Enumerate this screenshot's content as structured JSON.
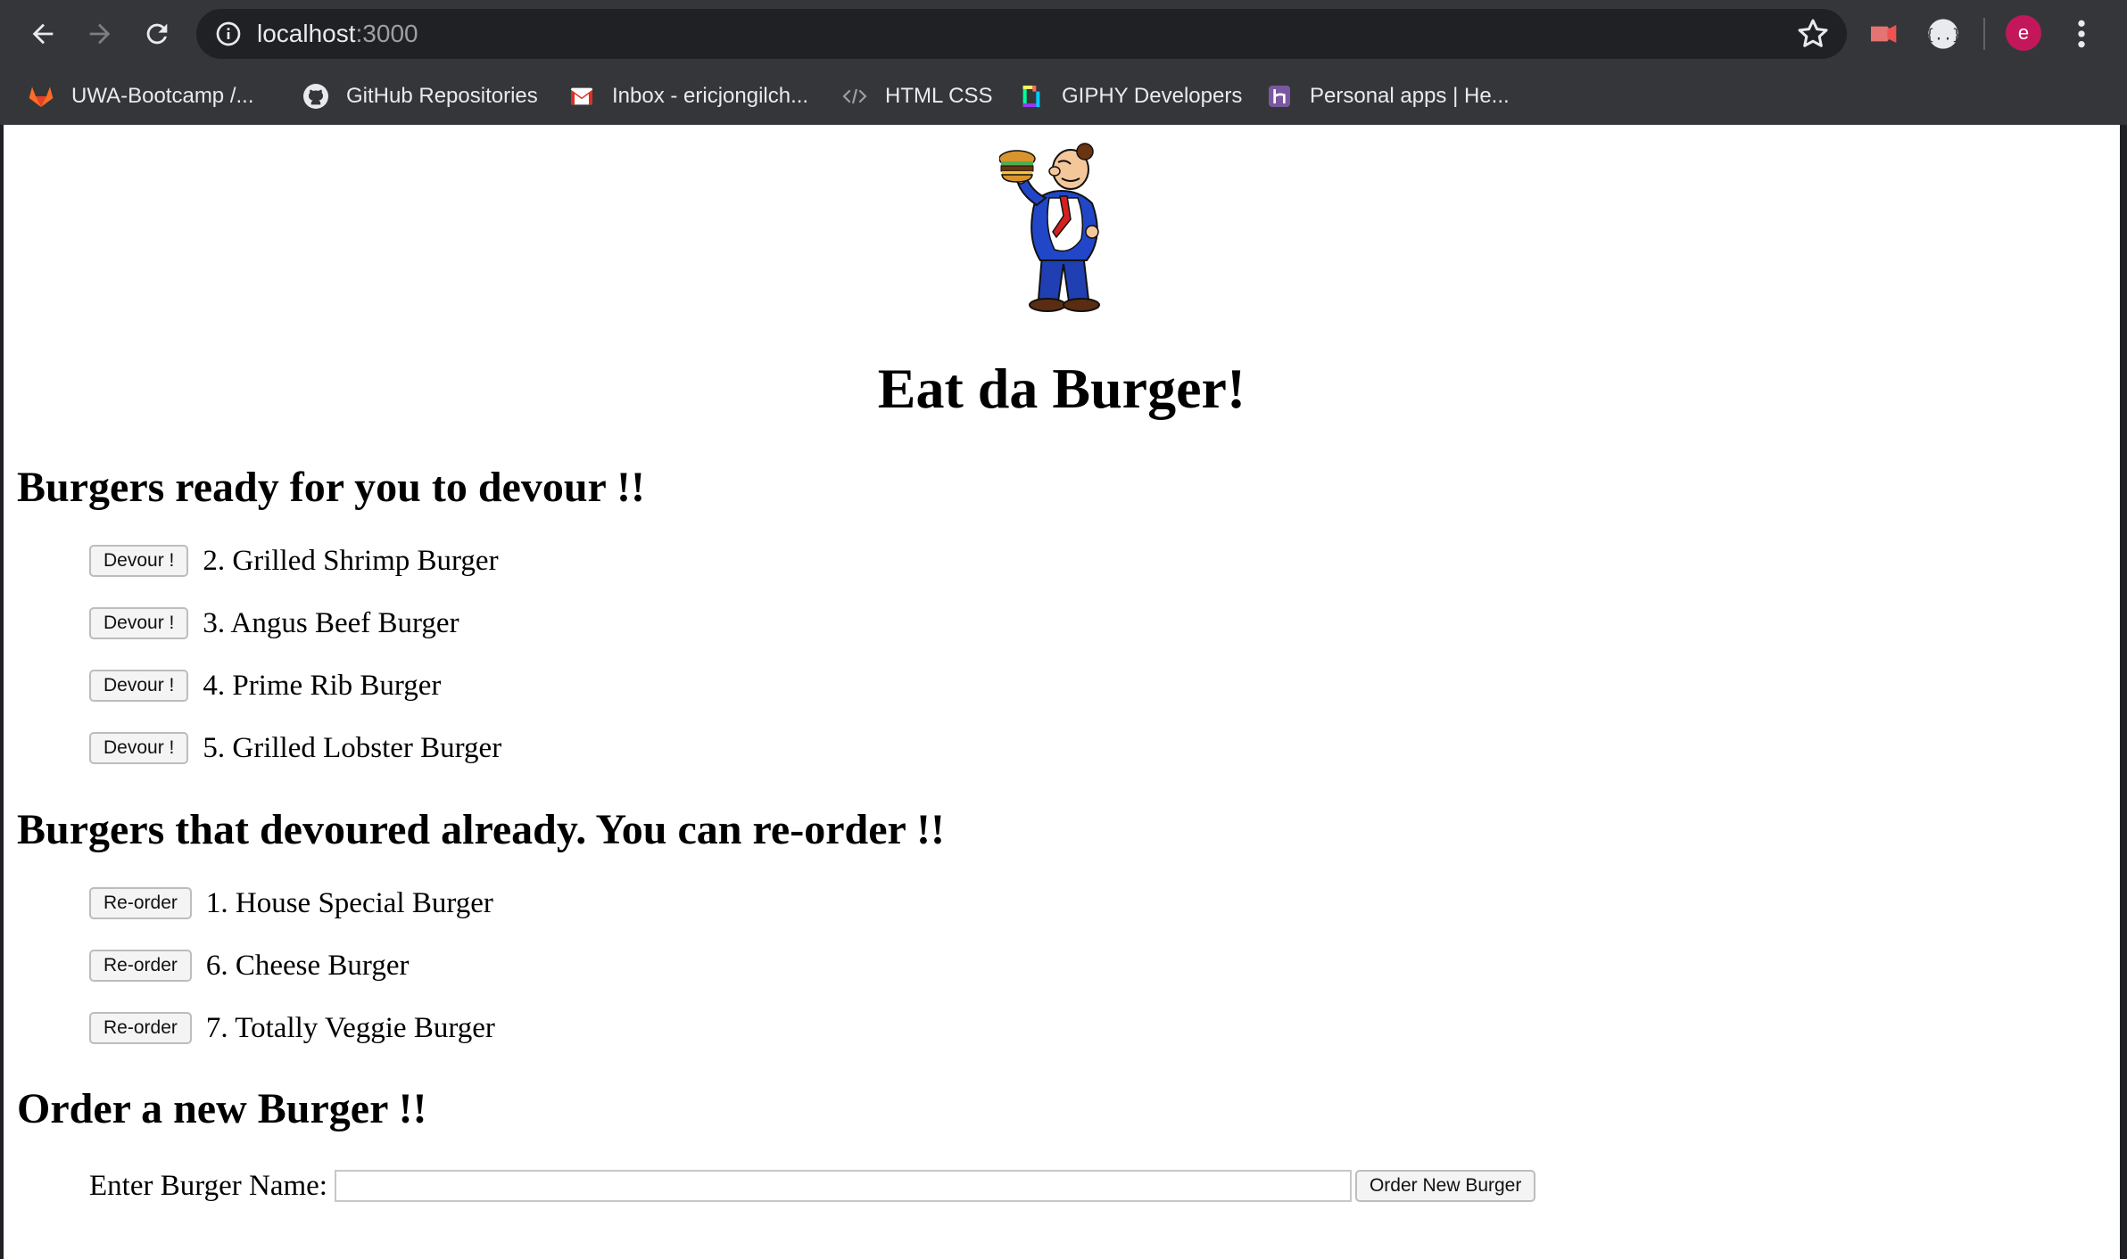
{
  "browser": {
    "url_host": "localhost",
    "url_port": ":3000",
    "profile_initial": "e",
    "bookmarks": [
      {
        "label": "UWA-Bootcamp /...",
        "icon": "gitlab-icon"
      },
      {
        "label": "GitHub Repositories",
        "icon": "github-icon"
      },
      {
        "label": "Inbox - ericjongilch...",
        "icon": "gmail-icon"
      },
      {
        "label": "HTML CSS",
        "icon": "code-icon"
      },
      {
        "label": "GIPHY Developers",
        "icon": "giphy-icon"
      },
      {
        "label": "Personal apps | He...",
        "icon": "heroku-icon"
      }
    ]
  },
  "page": {
    "title": "Eat da Burger!",
    "ready_heading": "Burgers ready for you to devour !!",
    "ready_items": [
      {
        "button": "Devour !",
        "label": "2. Grilled Shrimp Burger"
      },
      {
        "button": "Devour !",
        "label": "3. Angus Beef Burger"
      },
      {
        "button": "Devour !",
        "label": "4. Prime Rib Burger"
      },
      {
        "button": "Devour !",
        "label": "5. Grilled Lobster Burger"
      }
    ],
    "devoured_heading": "Burgers that devoured already. You can re-order !!",
    "devoured_items": [
      {
        "button": "Re-order",
        "label": "1. House Special Burger"
      },
      {
        "button": "Re-order",
        "label": "6. Cheese Burger"
      },
      {
        "button": "Re-order",
        "label": "7. Totally Veggie Burger"
      }
    ],
    "order_heading": "Order a new Burger !!",
    "order_label": "Enter Burger Name:",
    "order_input_value": "",
    "order_button": "Order New Burger"
  },
  "colors": {
    "chrome_bg": "#35363a",
    "omnibox_bg": "#202124",
    "avatar": "#c2185b",
    "page_bg": "#ffffff"
  }
}
